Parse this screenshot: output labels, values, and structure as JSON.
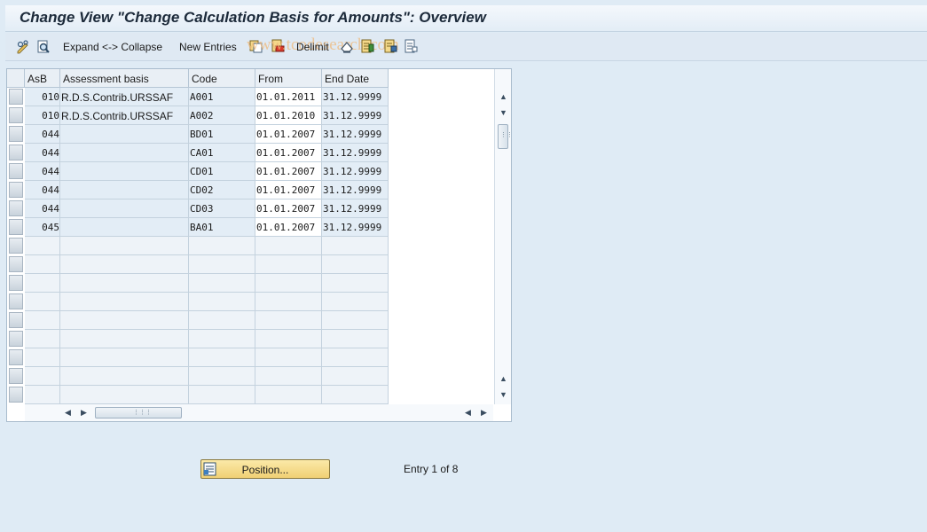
{
  "window": {
    "title": "Change View \"Change Calculation Basis for Amounts\": Overview"
  },
  "toolbar": {
    "expand_collapse_label": "Expand <-> Collapse",
    "new_entries_label": "New Entries",
    "delimit_label": "Delimit",
    "watermark": "www.tcodesearch.com",
    "icons": [
      "change-display-icon",
      "details-icon",
      "copy-as-icon",
      "delete-icon",
      "undo-change-icon",
      "select-all-icon",
      "select-block-icon",
      "deselect-all-icon"
    ]
  },
  "table": {
    "columns": [
      "AsB",
      "Assessment basis",
      "Code",
      "From",
      "End Date"
    ],
    "rows": [
      {
        "asb": "010",
        "basis": "R.D.S.Contrib.URSSAF",
        "code": "A001",
        "from": "01.01.2011",
        "end": "31.12.9999"
      },
      {
        "asb": "010",
        "basis": "R.D.S.Contrib.URSSAF",
        "code": "A002",
        "from": "01.01.2010",
        "end": "31.12.9999"
      },
      {
        "asb": "044",
        "basis": "",
        "code": "BD01",
        "from": "01.01.2007",
        "end": "31.12.9999"
      },
      {
        "asb": "044",
        "basis": "",
        "code": "CA01",
        "from": "01.01.2007",
        "end": "31.12.9999"
      },
      {
        "asb": "044",
        "basis": "",
        "code": "CD01",
        "from": "01.01.2007",
        "end": "31.12.9999"
      },
      {
        "asb": "044",
        "basis": "",
        "code": "CD02",
        "from": "01.01.2007",
        "end": "31.12.9999"
      },
      {
        "asb": "044",
        "basis": "",
        "code": "CD03",
        "from": "01.01.2007",
        "end": "31.12.9999"
      },
      {
        "asb": "045",
        "basis": "",
        "code": "BA01",
        "from": "01.01.2007",
        "end": "31.12.9999"
      }
    ],
    "empty_rows": 9
  },
  "footer": {
    "position_button_label": "Position...",
    "entry_info": "Entry 1 of 8"
  },
  "colors": {
    "background": "#dfebf5",
    "readonly_cell": "#e3edf6",
    "button_yellow": "#f0d074"
  }
}
